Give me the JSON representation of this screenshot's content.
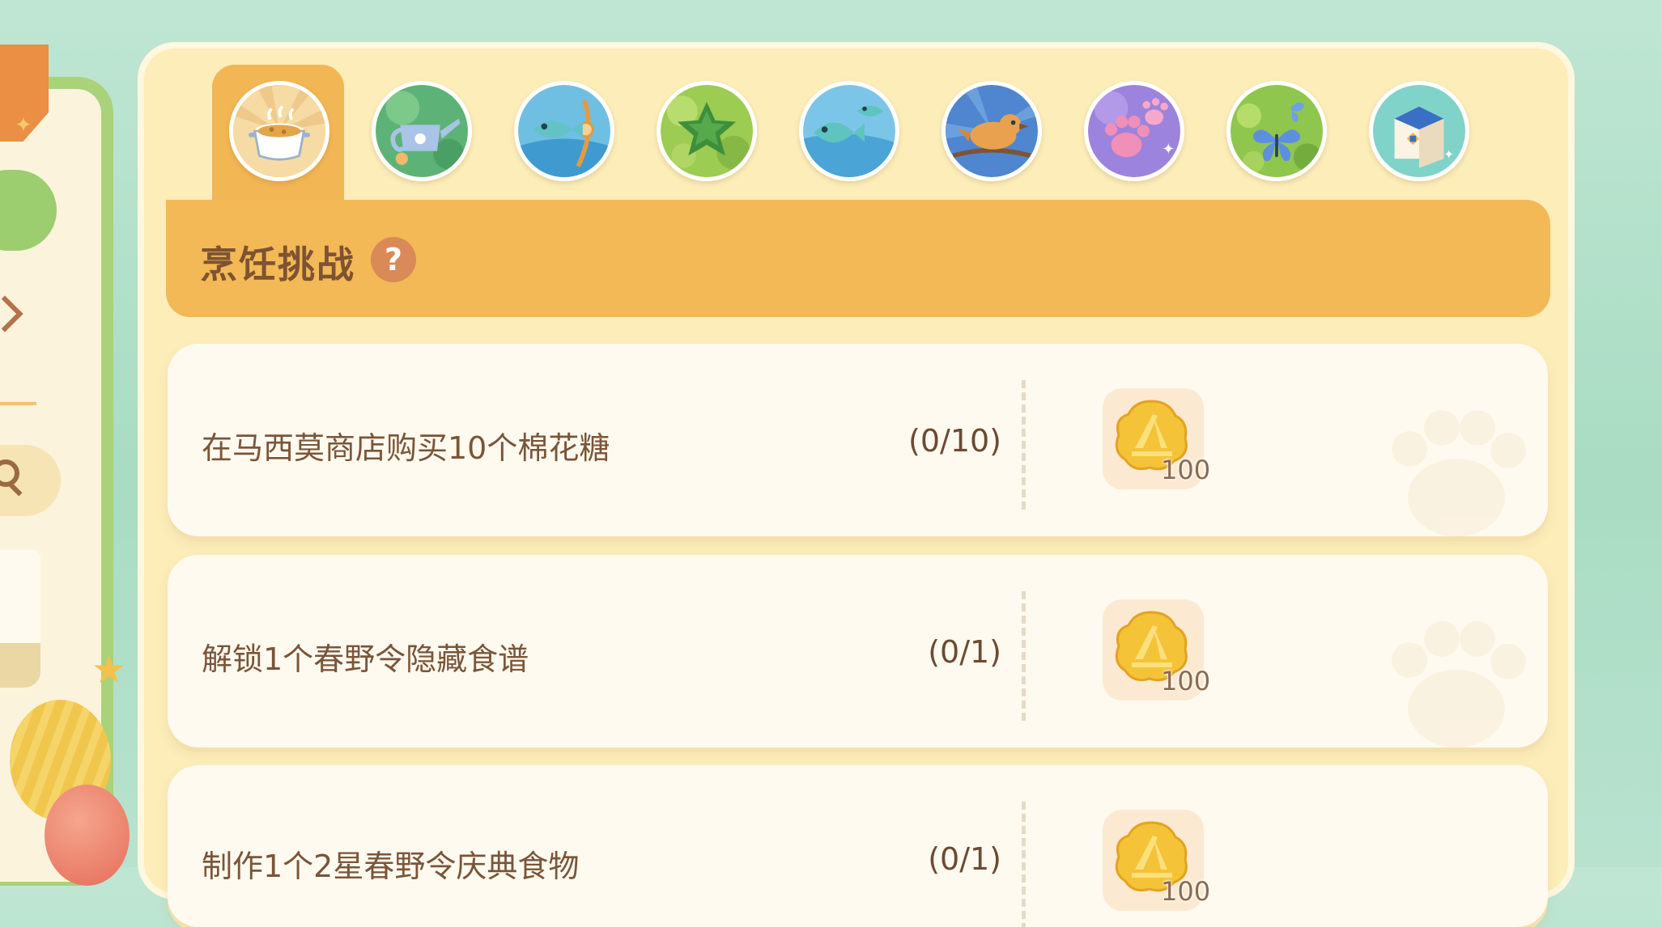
{
  "tabs": [
    {
      "name": "cooking",
      "icon": "cooking-pot-icon",
      "active": true
    },
    {
      "name": "gardening",
      "icon": "watering-can-icon",
      "active": false
    },
    {
      "name": "fishing",
      "icon": "fishing-icon",
      "active": false
    },
    {
      "name": "gathering",
      "icon": "star-gathering-icon",
      "active": false
    },
    {
      "name": "fish-collection",
      "icon": "fish-icon",
      "active": false
    },
    {
      "name": "bird-watching",
      "icon": "bird-icon",
      "active": false
    },
    {
      "name": "pets",
      "icon": "paw-icon",
      "active": false
    },
    {
      "name": "insects",
      "icon": "butterfly-icon",
      "active": false
    },
    {
      "name": "home",
      "icon": "box-icon",
      "active": false
    }
  ],
  "header": {
    "title": "烹饪挑战",
    "help": "?"
  },
  "tasks": [
    {
      "text": "在马西莫商店购买10个棉花糖",
      "progress": "(0/10)",
      "reward": {
        "icon": "coin-icon",
        "count": "100"
      }
    },
    {
      "text": "解锁1个春野令隐藏食谱",
      "progress": "(0/1)",
      "reward": {
        "icon": "coin-icon",
        "count": "100"
      }
    },
    {
      "text": "制作1个2星春野令庆典食物",
      "progress": "(0/1)",
      "reward": {
        "icon": "coin-icon",
        "count": "100"
      }
    }
  ],
  "colors": {
    "accent": "#f3b957",
    "panel": "#fcedb9",
    "card": "#fffaf0",
    "text": "#7a5538"
  }
}
